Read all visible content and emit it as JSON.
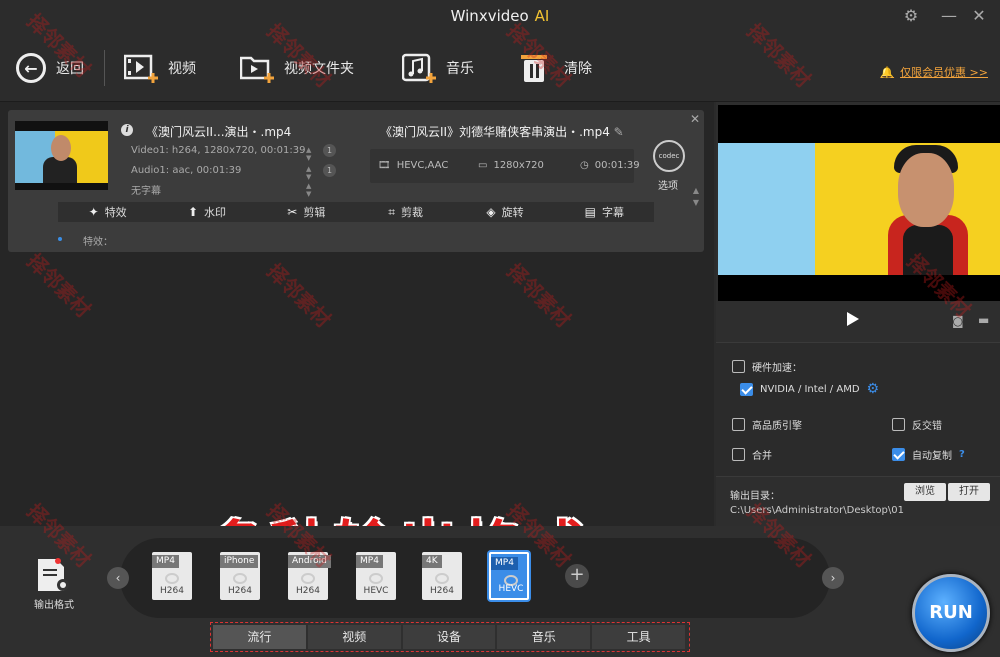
{
  "titlebar": {
    "app_name": "Winxvideo",
    "app_suffix": "AI"
  },
  "toolbar": {
    "back": "返回",
    "video": "视频",
    "video_folder": "视频文件夹",
    "music": "音乐",
    "clear": "清除",
    "promo": "仅限会员优惠 >>"
  },
  "file": {
    "source_name": "《澳门风云II...演出・.mp4",
    "video_meta": "Video1: h264, 1280x720, 00:01:39",
    "audio_meta": "Audio1: aac, 00:01:39",
    "subtitle": "无字幕",
    "video_count": "1",
    "audio_count": "1",
    "output_name": "《澳门风云II》刘德华赌侠客串演出・.mp4",
    "out_codec": "HEVC,AAC",
    "out_resolution": "1280x720",
    "out_duration": "00:01:39",
    "codec_icon_text": "codec",
    "options_label": "选项",
    "effects_label": "特效："
  },
  "edit_bar": [
    "特效",
    "水印",
    "剪辑",
    "剪裁",
    "旋转",
    "字幕"
  ],
  "overlay_text": "多种输出格式",
  "options": {
    "hw_accel": "硬件加速：",
    "gpu": "NVIDIA / Intel / AMD",
    "high_quality": "高品质引擎",
    "deinterlace": "反交错",
    "merge": "合并",
    "auto_copy": "自动复制",
    "help": "?",
    "output_dir_label": "输出目录：",
    "output_dir": "C:\\Users\\Administrator\\Desktop\\01",
    "browse": "浏览",
    "open": "打开"
  },
  "formats": {
    "label": "输出格式",
    "items": [
      {
        "tag": "MP4",
        "sub": "H264"
      },
      {
        "tag": "iPhone",
        "sub": "H264"
      },
      {
        "tag": "Android",
        "sub": "H264"
      },
      {
        "tag": "MP4",
        "sub": "HEVC"
      },
      {
        "tag": "4K",
        "sub": "H264"
      },
      {
        "tag": "MP4",
        "sub": "HEVC"
      }
    ]
  },
  "tabs": [
    "流行",
    "视频",
    "设备",
    "音乐",
    "工具"
  ],
  "run_label": "RUN",
  "watermark": "择邻素材",
  "colors": {
    "accent": "#3b8de8",
    "promo": "#f2a33c",
    "overlay": "#e21d1d"
  }
}
